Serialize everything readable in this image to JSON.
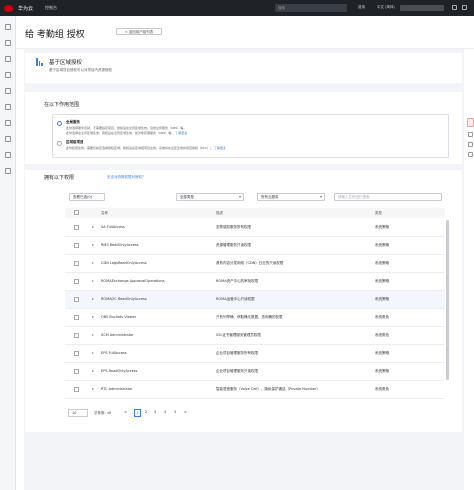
{
  "topbar": {
    "brand": "华为云",
    "console": "控制台",
    "search_placeholder": "搜索",
    "links": [
      "费用",
      "中文 (简体)"
    ]
  },
  "page": {
    "title": "给 考勤组 授权",
    "back_label": "< 返回用户组列表"
  },
  "header_card": {
    "title": "基于区域授权",
    "subtitle": "基于区域项目授权可以对项目内资源授权"
  },
  "scope": {
    "title": "在以下作用范围",
    "options": [
      {
        "title": "全局服务",
        "desc1": "此时选择服务自动，不需要指定项目，授权后在全局区域生效。目前全局服务（OBS）等。",
        "desc2": "此时选择在全局区域生效，授权后在全局区域生效，如对象存储服务（OBS）等。",
        "link": "了解更多",
        "selected": true
      },
      {
        "title": "区域级项目",
        "desc1": "此时权限生效，需要仅指定选择授权区域。授权后在区域级项目生效，系统将在全区生效的项目授权（ECS）。",
        "link": "了解更多",
        "selected": false
      }
    ]
  },
  "permissions": {
    "title": "拥有以下权限",
    "link": "无法对特殊权限对授权？",
    "toolbar": {
      "selected_label": "查看已选(0)",
      "filter1": "全部类型",
      "filter2": "所有云服务",
      "search_placeholder": "请输入名称进行搜索"
    },
    "columns": [
      "名称",
      "描述",
      "类型"
    ],
    "rows": [
      {
        "name": "SA FullAccess",
        "desc": "态势感知服务所有权限",
        "type": "系统策略"
      },
      {
        "name": "RMS ReadOnlyAccess",
        "desc": "资源管理服务只读权限",
        "type": "系统策略"
      },
      {
        "name": "CDN LogsReadOnlyAccess",
        "desc": "具有内容分发网络（CDN）日志的只读权限",
        "type": "系统策略"
      },
      {
        "name": "ROMAExchange ApprovalOperations",
        "desc": "ROMA资产中心的审批权限",
        "type": "系统策略"
      },
      {
        "name": "ROMAOC ReadOnlyAccess",
        "desc": "ROMA运营中心只读权限",
        "type": "系统策略"
      },
      {
        "name": "OBS Buckets Viewer",
        "desc": "只有列举桶、获取桶元数据、查询桶的权限",
        "type": "系统角色"
      },
      {
        "name": "SCM Administrator",
        "desc": "SSL证书管理服务管理员权限",
        "type": "系统角色"
      },
      {
        "name": "EPS FullAccess",
        "desc": "企业项目管理服务所有权限",
        "type": "系统策略"
      },
      {
        "name": "EPS ReadOnlyAccess",
        "desc": "企业项目管理服务只读权限",
        "type": "系统策略"
      },
      {
        "name": "RTC Administrator",
        "desc": "智能语音服务（Voice Call）、隐私保护通话（Private Number）",
        "type": "系统角色"
      }
    ],
    "pager": {
      "page_size": "10",
      "total": "总条数: 46",
      "pages": [
        "1",
        "2",
        "3",
        "4",
        "5"
      ],
      "prev": "<",
      "next": ">"
    }
  },
  "colors": {
    "accent": "#3f7ee8",
    "topbar": "#1f2227",
    "brand_red": "#c7000b"
  }
}
